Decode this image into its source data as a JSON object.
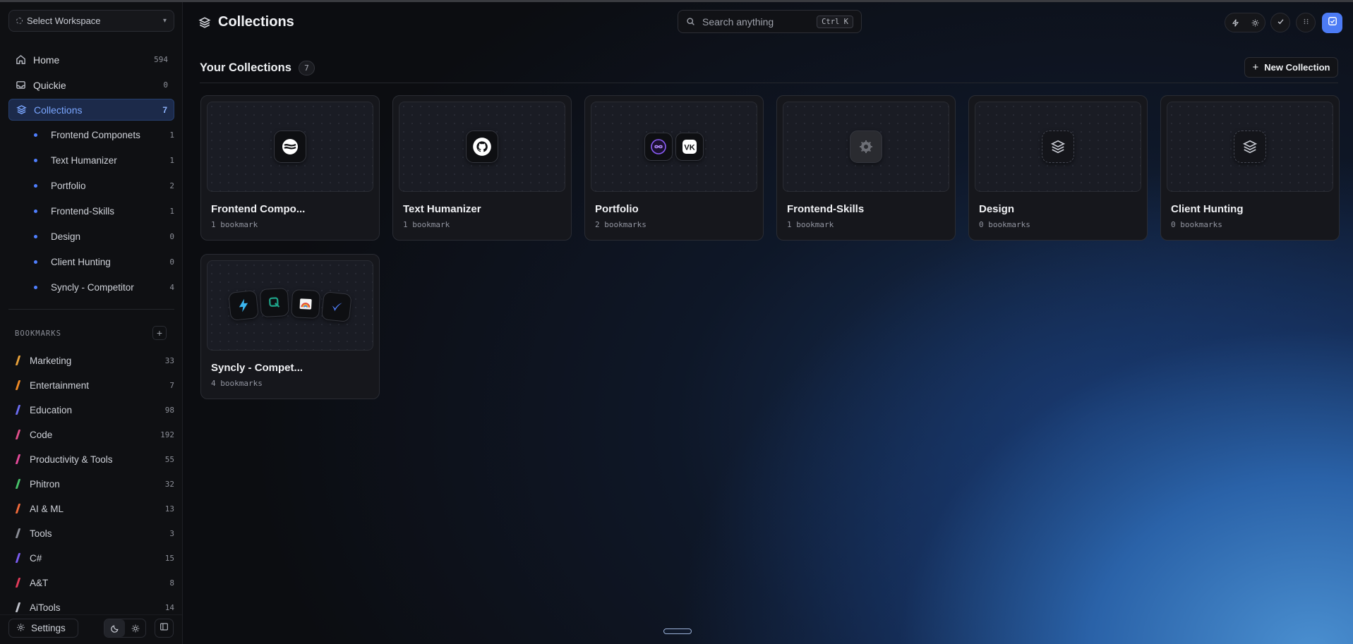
{
  "workspace": {
    "label": "Select Workspace"
  },
  "nav": [
    {
      "label": "Home",
      "count": "594"
    },
    {
      "label": "Quickie",
      "count": "0"
    },
    {
      "label": "Collections",
      "count": "7"
    }
  ],
  "collections_tree": [
    {
      "label": "Frontend Componets",
      "count": "1"
    },
    {
      "label": "Text Humanizer",
      "count": "1"
    },
    {
      "label": "Portfolio",
      "count": "2"
    },
    {
      "label": "Frontend-Skills",
      "count": "1"
    },
    {
      "label": "Design",
      "count": "0"
    },
    {
      "label": "Client Hunting",
      "count": "0"
    },
    {
      "label": "Syncly - Competitor",
      "count": "4"
    }
  ],
  "bookmarks_section": {
    "title": "BOOKMARKS",
    "add_icon": "plus-icon"
  },
  "bookmarks": [
    {
      "label": "Marketing",
      "count": "33",
      "color": "#e8a13a"
    },
    {
      "label": "Entertainment",
      "count": "7",
      "color": "#f08a24"
    },
    {
      "label": "Education",
      "count": "98",
      "color": "#6b6cf0"
    },
    {
      "label": "Code",
      "count": "192",
      "color": "#e04f8a"
    },
    {
      "label": "Productivity & Tools",
      "count": "55",
      "color": "#e44a9a"
    },
    {
      "label": "Phitron",
      "count": "32",
      "color": "#48c26a"
    },
    {
      "label": "AI & ML",
      "count": "13",
      "color": "#f06a3a"
    },
    {
      "label": "Tools",
      "count": "3",
      "color": "#8a8d96"
    },
    {
      "label": "C#",
      "count": "15",
      "color": "#7a5cf0"
    },
    {
      "label": "A&T",
      "count": "8",
      "color": "#e23b5a"
    },
    {
      "label": "AiTools",
      "count": "14",
      "color": "#c0c3cc"
    }
  ],
  "footer": {
    "settings_label": "Settings"
  },
  "header": {
    "title": "Collections"
  },
  "search": {
    "placeholder": "Search anything",
    "shortcut": "Ctrl K"
  },
  "section": {
    "title": "Your Collections",
    "count": "7",
    "new_button": "New Collection"
  },
  "cards": [
    {
      "name": "Frontend Compo...",
      "meta": "1 bookmark",
      "icons": [
        "webflow-icon"
      ]
    },
    {
      "name": "Text Humanizer",
      "meta": "1 bookmark",
      "icons": [
        "github-icon"
      ]
    },
    {
      "name": "Portfolio",
      "meta": "2 bookmarks",
      "icons": [
        "infinity-icon",
        "vk-icon"
      ]
    },
    {
      "name": "Frontend-Skills",
      "meta": "1 bookmark",
      "icons": [
        "gear-icon"
      ]
    },
    {
      "name": "Design",
      "meta": "0 bookmarks",
      "icons": [
        "layers-icon"
      ]
    },
    {
      "name": "Client Hunting",
      "meta": "0 bookmarks",
      "icons": [
        "layers-icon"
      ]
    },
    {
      "name": "Syncly - Compet...",
      "meta": "4 bookmarks",
      "icons": [
        "bolt-icon",
        "swirl-icon",
        "rainbow-icon",
        "check-icon"
      ]
    }
  ],
  "accent": "#4c7bf5"
}
